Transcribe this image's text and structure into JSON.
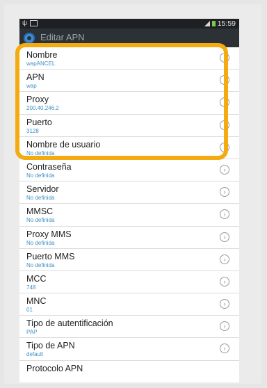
{
  "status_bar": {
    "time": "15:59",
    "left_icons": "ψ"
  },
  "action_bar": {
    "title": "Editar APN"
  },
  "items": [
    {
      "title": "Nombre",
      "value": "wapANCEL"
    },
    {
      "title": "APN",
      "value": "wap"
    },
    {
      "title": "Proxy",
      "value": "200.40.246.2"
    },
    {
      "title": "Puerto",
      "value": "3128"
    },
    {
      "title": "Nombre de usuario",
      "value": "No definida"
    },
    {
      "title": "Contraseña",
      "value": "No definida"
    },
    {
      "title": "Servidor",
      "value": "No definida"
    },
    {
      "title": "MMSC",
      "value": "No definida"
    },
    {
      "title": "Proxy MMS",
      "value": "No definida"
    },
    {
      "title": "Puerto MMS",
      "value": "No definida"
    },
    {
      "title": "MCC",
      "value": "748"
    },
    {
      "title": "MNC",
      "value": "01"
    },
    {
      "title": "Tipo de autentificación",
      "value": "PAP"
    },
    {
      "title": "Tipo de APN",
      "value": "default"
    },
    {
      "title": "Protocolo APN",
      "value": ""
    }
  ],
  "colors": {
    "highlight": "#f4ab12",
    "subtext": "#3f8fc4",
    "actionbar": "#2c3136",
    "statusbar": "#1f2023"
  }
}
